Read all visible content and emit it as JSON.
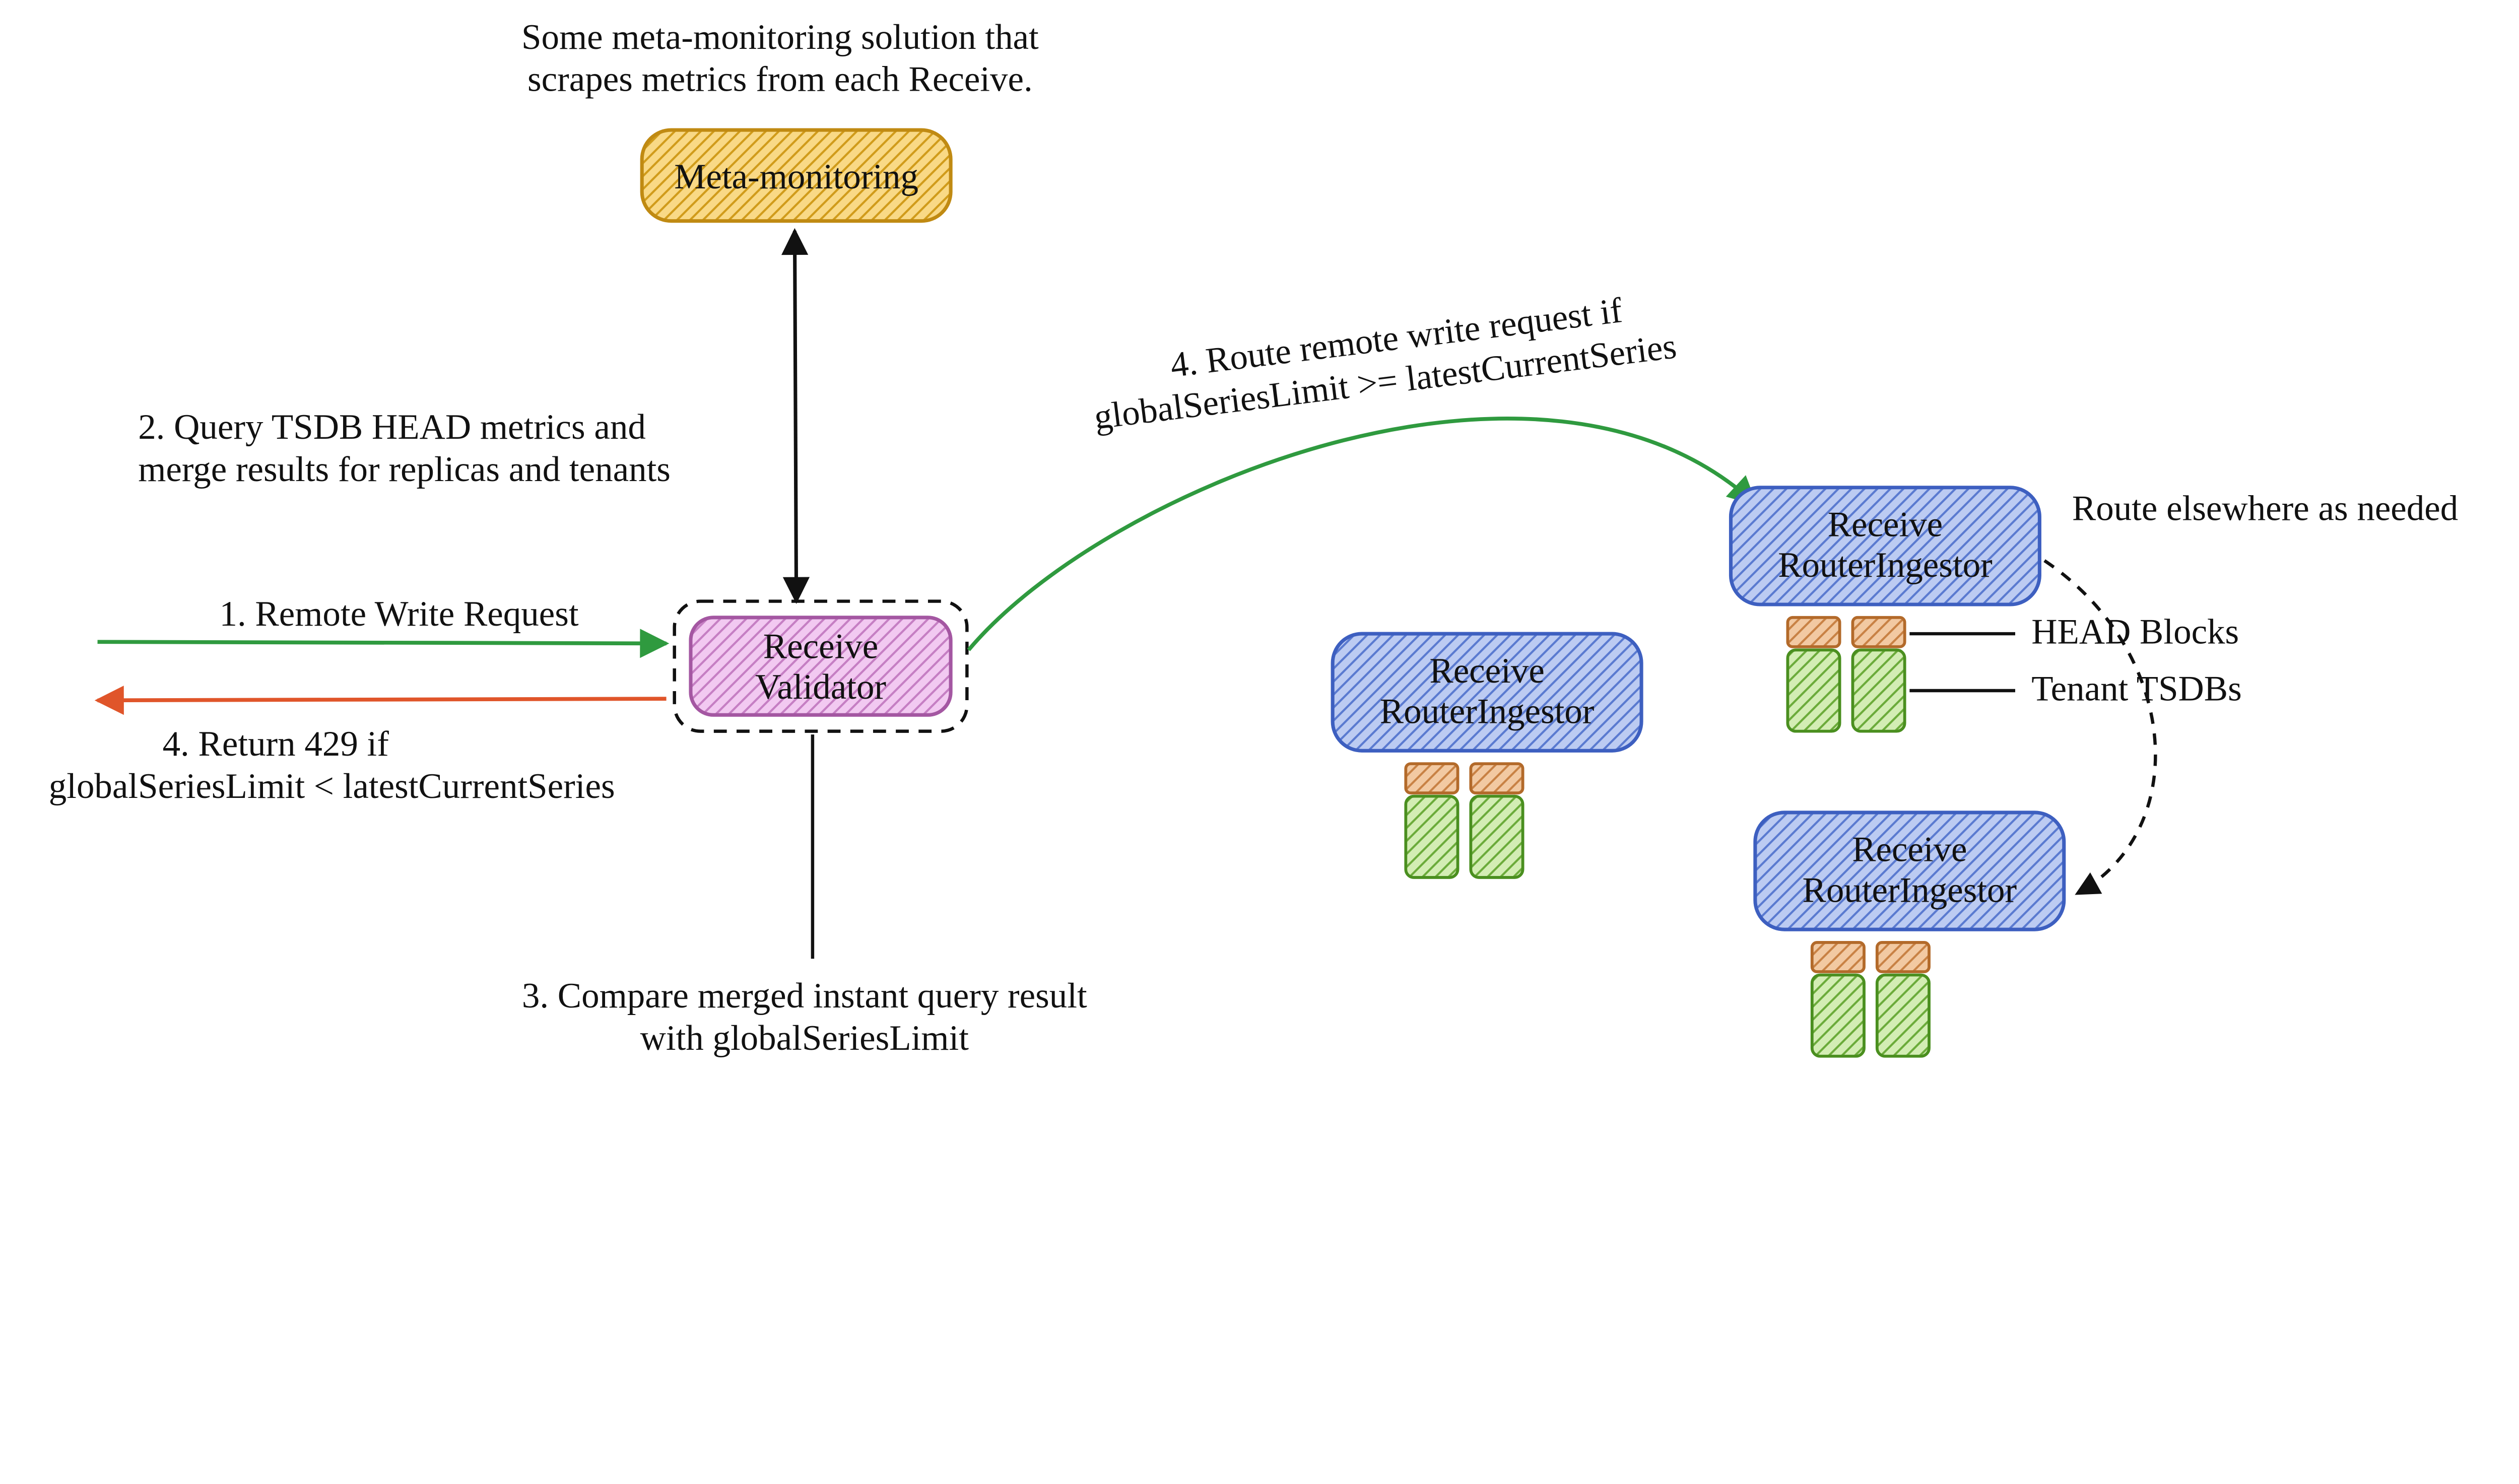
{
  "meta": {
    "caption_line1": "Some meta-monitoring solution that",
    "caption_line2": "scrapes metrics from each Receive.",
    "label": "Meta-monitoring"
  },
  "validator": {
    "label_line1": "Receive",
    "label_line2": "Validator"
  },
  "router": {
    "label_line1": "Receive",
    "label_line2": "RouterIngestor"
  },
  "labels": {
    "head_blocks": "HEAD Blocks",
    "tenant_tsdbs": "Tenant TSDBs",
    "route_elsewhere": "Route elsewhere as needed"
  },
  "steps": {
    "s1": "1. Remote Write Request",
    "s2_line1": "2. Query TSDB HEAD metrics and",
    "s2_line2": "merge results for replicas and tenants",
    "s3_line1": "3. Compare merged instant query result",
    "s3_line2": "with globalSeriesLimit",
    "s4route_line1": "4. Route remote write request if",
    "s4route_line2": "globalSeriesLimit >= latestCurrentSeries",
    "s4err_line1": "4. Return 429 if",
    "s4err_line2": "globalSeriesLimit < latestCurrentSeries"
  },
  "colors": {
    "meta_fill": "#f5c24a",
    "meta_stroke": "#d09b1a",
    "validator_fill": "#e9aee8",
    "validator_stroke": "#b062ae",
    "router_fill": "#6e8fe0",
    "router_stroke": "#3d5fc0",
    "tsdb_fill": "#9ad061",
    "tsdb_stroke": "#4a8f1f",
    "head_fill": "#e39a5a",
    "head_stroke": "#b36a2a",
    "arrow_green": "#2f9a3f",
    "arrow_red": "#e0552a",
    "arrow_black": "#111111"
  }
}
